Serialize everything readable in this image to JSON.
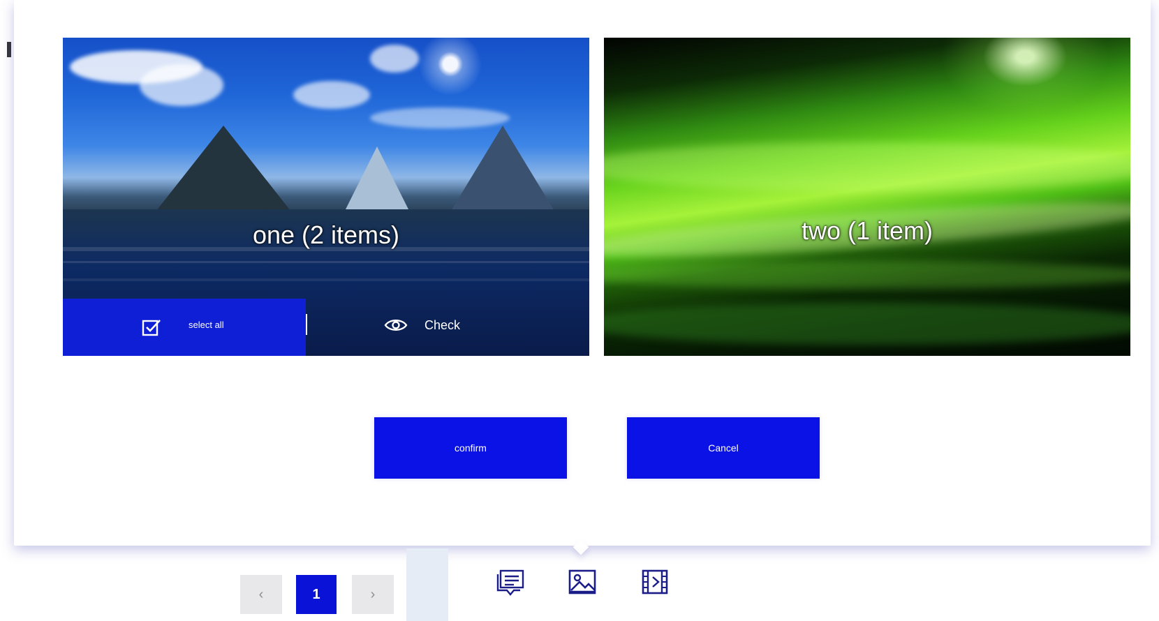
{
  "popover": {
    "cards": [
      {
        "label": "one (2 items)",
        "select_all": "select all",
        "check": "Check"
      },
      {
        "label": "two (1 item)"
      }
    ],
    "actions": {
      "confirm": "confirm",
      "cancel": "Cancel"
    }
  },
  "pager": {
    "prev": "‹",
    "current": "1",
    "next": "›"
  },
  "toolbar": {
    "icons": [
      "text-message-icon",
      "image-icon",
      "video-icon"
    ]
  },
  "colors": {
    "accent": "#0a12e6",
    "pager_inactive": "#e8e8ea",
    "shadow": "#5a5abe"
  }
}
